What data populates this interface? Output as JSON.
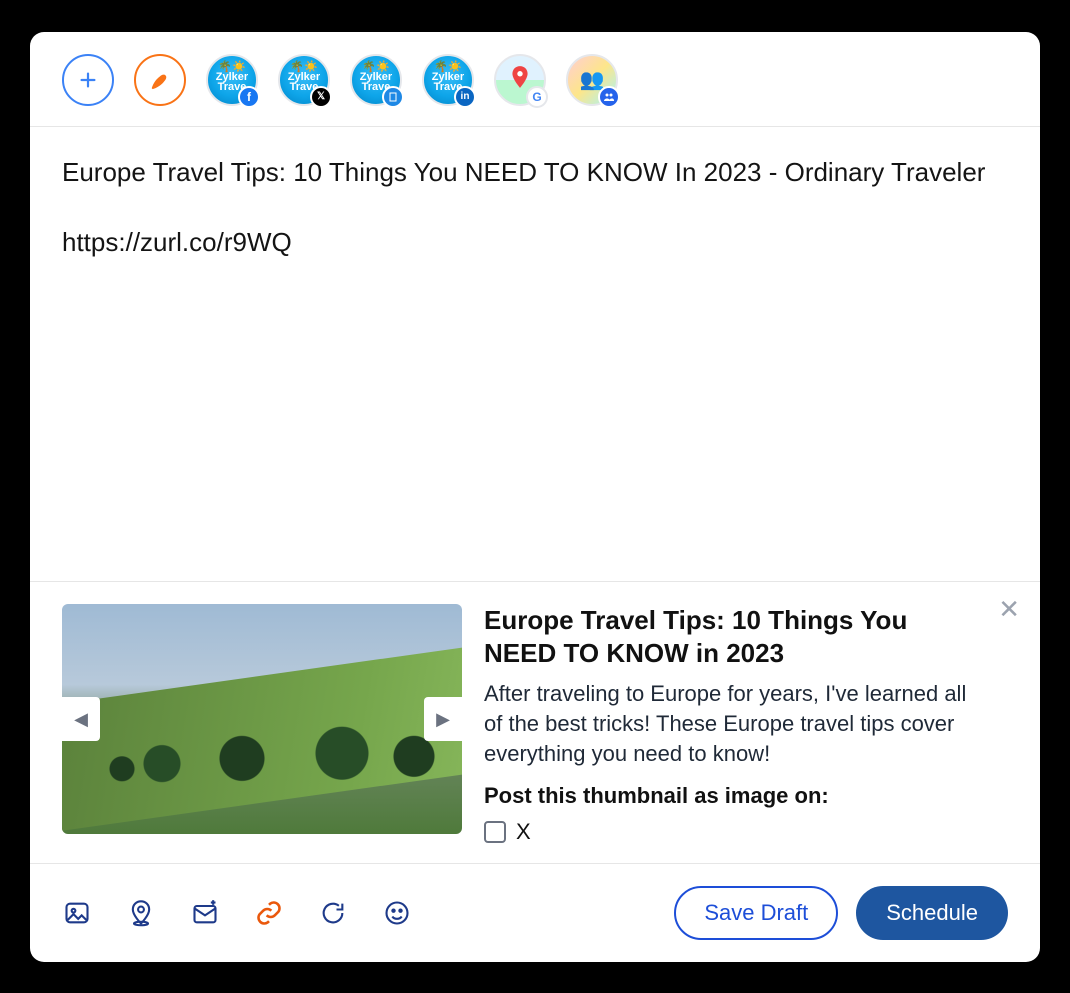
{
  "channels": {
    "zylker_label": "Zylker\nTrave"
  },
  "compose": {
    "text": "Europe Travel Tips: 10 Things You NEED TO KNOW In 2023 - Ordinary Traveler",
    "link": "https://zurl.co/r9WQ"
  },
  "preview": {
    "title": "Europe Travel Tips: 10 Things You NEED TO KNOW in 2023",
    "description": "After traveling to Europe for years, I've learned all of the best tricks! These Europe travel tips cover everything you need to know!",
    "post_as_label": "Post this thumbnail as image on:",
    "checkbox_x_label": "X"
  },
  "footer": {
    "save_draft_label": "Save Draft",
    "schedule_label": "Schedule"
  }
}
